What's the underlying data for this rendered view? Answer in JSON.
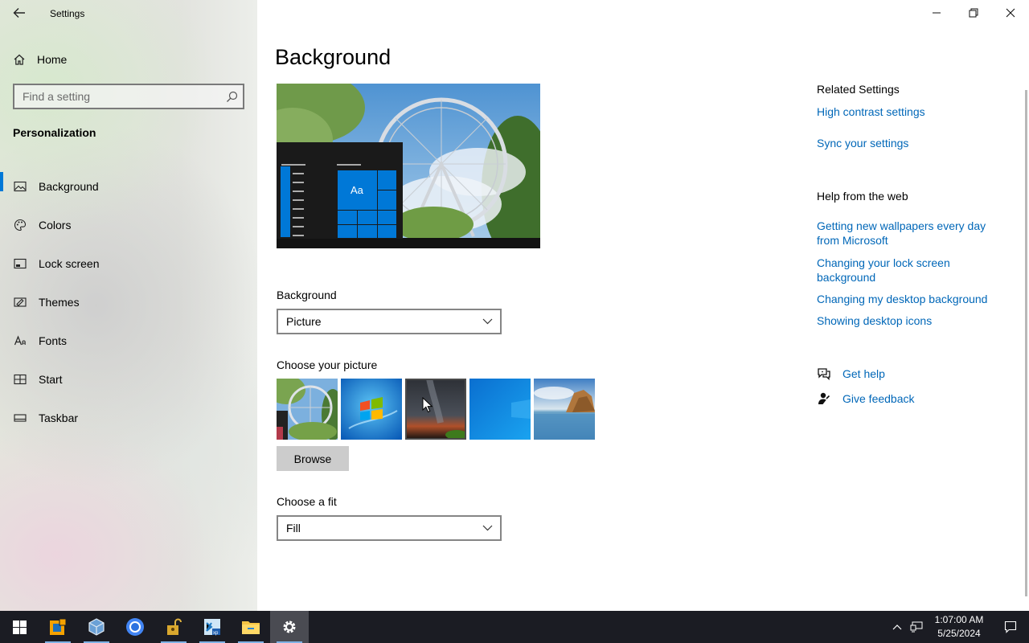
{
  "window": {
    "title": "Settings"
  },
  "sidebar": {
    "home_label": "Home",
    "search_placeholder": "Find a setting",
    "section": "Personalization",
    "items": [
      {
        "label": "Background",
        "icon": "picture-icon",
        "selected": true
      },
      {
        "label": "Colors",
        "icon": "palette-icon",
        "selected": false
      },
      {
        "label": "Lock screen",
        "icon": "lock-screen-icon",
        "selected": false
      },
      {
        "label": "Themes",
        "icon": "themes-icon",
        "selected": false
      },
      {
        "label": "Fonts",
        "icon": "fonts-icon",
        "selected": false
      },
      {
        "label": "Start",
        "icon": "start-icon",
        "selected": false
      },
      {
        "label": "Taskbar",
        "icon": "taskbar-icon",
        "selected": false
      }
    ]
  },
  "main": {
    "title": "Background",
    "preview_tile_text": "Aa",
    "background_label": "Background",
    "background_value": "Picture",
    "choose_picture_label": "Choose your picture",
    "pictures": [
      {
        "name": "ferris-wheel-thumb",
        "selected": false
      },
      {
        "name": "windows-7-logo-thumb",
        "selected": false
      },
      {
        "name": "night-sky-thumb",
        "selected": true
      },
      {
        "name": "windows-10-blue-thumb",
        "selected": false
      },
      {
        "name": "beach-rocks-thumb",
        "selected": false
      }
    ],
    "browse_label": "Browse",
    "fit_label": "Choose a fit",
    "fit_value": "Fill"
  },
  "related": {
    "heading": "Related Settings",
    "links": [
      "High contrast settings",
      "Sync your settings"
    ]
  },
  "help_web": {
    "heading": "Help from the web",
    "links": [
      "Getting new wallpapers every day from Microsoft",
      "Changing your lock screen background",
      "Changing my desktop background",
      "Showing desktop icons"
    ]
  },
  "support": {
    "get_help": "Get help",
    "give_feedback": "Give feedback"
  },
  "taskbar": {
    "apps": [
      "start-icon",
      "virtualbox-manager-icon",
      "virtualbox-cube-icon",
      "chrome-icon",
      "unlock-tool-icon",
      "windows-xp-installer-icon",
      "file-explorer-icon",
      "settings-gear-icon"
    ],
    "time": "1:07:00 AM",
    "date": "5/25/2024"
  },
  "colors": {
    "accent": "#0078d7",
    "link": "#0067b8",
    "taskbar": "#1b1c23"
  }
}
